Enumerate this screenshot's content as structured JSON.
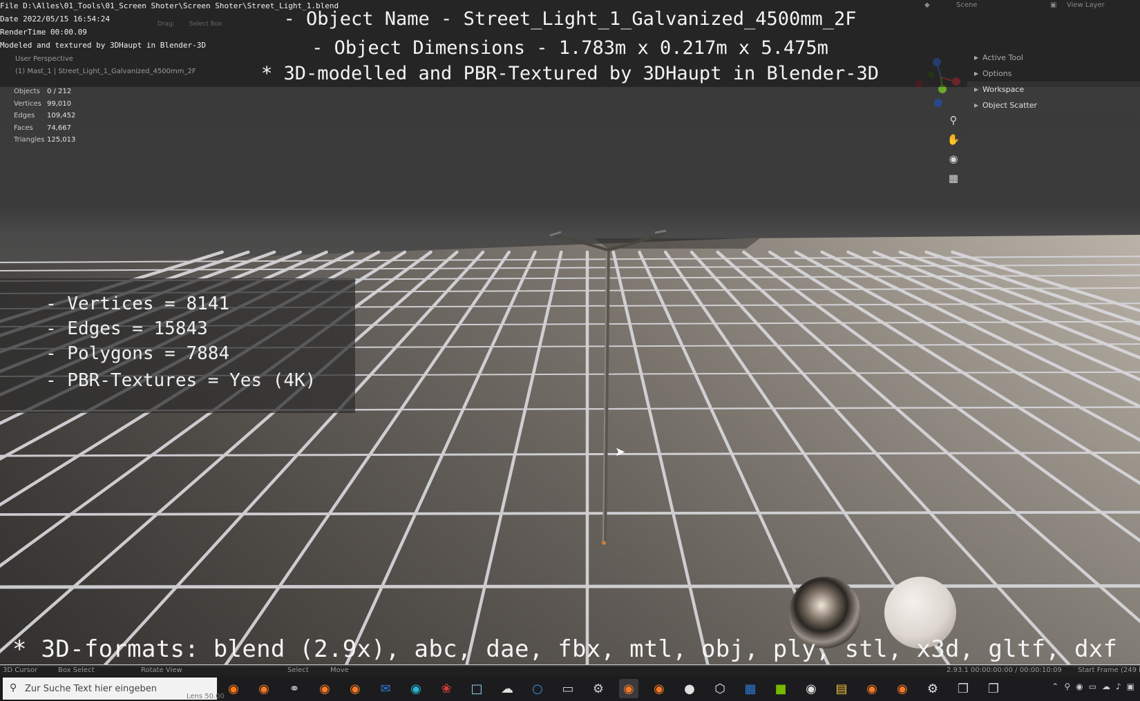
{
  "file_info": {
    "file": "File D:\\Alles\\01_Tools\\01_Screen Shoter\\Screen Shoter\\Street_Light_1.blend",
    "date": "Date 2022/05/15 16:54:24",
    "render_time": "RenderTime 00:00.09",
    "credit": "Modeled and textured by 3DHaupt in Blender-3D"
  },
  "overlay": {
    "object_name": "- Object Name - Street_Light_1_Galvanized_4500mm_2F",
    "object_dimensions": "- Object Dimensions -  1.783m x 0.217m x 5.475m",
    "modelled_by": "* 3D-modelled and PBR-Textured by 3DHaupt in Blender-3D"
  },
  "viewport": {
    "perspective": "User Perspective",
    "collection": "(1) Mast_1 | Street_Light_1_Galvanized_4500mm_2F",
    "stats": [
      {
        "label": "Objects",
        "value": "0 / 212"
      },
      {
        "label": "Vertices",
        "value": "99,010"
      },
      {
        "label": "Edges",
        "value": "109,452"
      },
      {
        "label": "Faces",
        "value": "74,667"
      },
      {
        "label": "Triangles",
        "value": "125,013"
      }
    ]
  },
  "infobox": {
    "vertices": "- Vertices = 8141",
    "edges": "- Edges = 15843",
    "polygons": "- Polygons = 7884",
    "textures": "- PBR-Textures =  Yes (4K)"
  },
  "formats": "* 3D-formats: blend (2.9x), abc, dae, fbx, mtl, obj, ply, stl, x3d, gltf, dxf",
  "right_panel": {
    "items": [
      "Active Tool",
      "Options",
      "Workspace",
      "Object Scatter"
    ]
  },
  "top_bar": {
    "scene": "Scene",
    "view_layer": "View Layer"
  },
  "header_tools": {
    "drag_label": "Drag:",
    "select_box": "Select Box"
  },
  "status_bar": {
    "cursor": "3D Cursor",
    "box_select": "Box Select",
    "rotate_view": "Rotate View",
    "select": "Select",
    "move": "Move",
    "version": "2.93.1  00:00:00:00 / 00:00:10:09",
    "start_frame": "Start Frame (249 le"
  },
  "taskbar": {
    "search_placeholder": "Zur Suche Text hier eingeben",
    "lens": "Lens 50.00"
  },
  "colors": {
    "grid_line": "#d8d8dc",
    "floor_dark": "#4d4a47",
    "floor_light": "#b9b0a4",
    "taskbar_bg": "#1c1c1e",
    "accent_green": "#76b900",
    "accent_blue": "#2b7bd6"
  }
}
